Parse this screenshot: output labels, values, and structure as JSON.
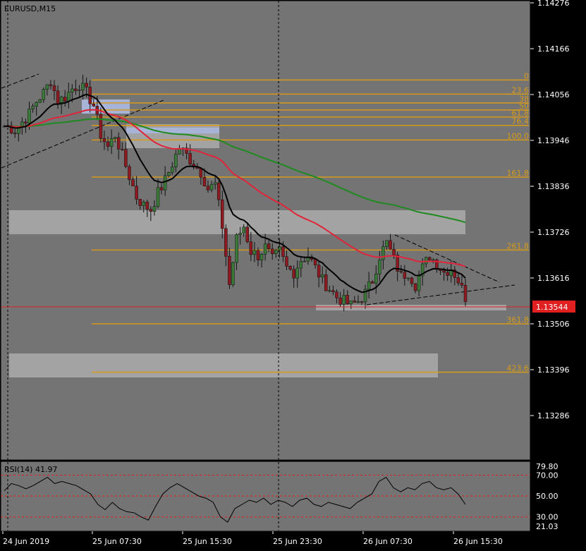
{
  "window": {
    "title": "EURUSD,M15",
    "rsi_title": "RSI(14) 41.97"
  },
  "colors": {
    "background": "#747474",
    "frame": "#000000",
    "candle_up": "#3a7a38",
    "candle_down": "#8c1a20",
    "ema_fast": "#000000",
    "ema_mid": "#e0253a",
    "ema_slow": "#1f8a1f",
    "fib": "#d79a1a",
    "zone": "#a3a3a3",
    "zone_blue": "#a7b4d8",
    "price_line": "#e02020",
    "price_tag_bg": "#e02020",
    "rsi_line": "#000000",
    "rsi_level": "#e02020"
  },
  "price_axis": {
    "ticks": [
      "1.14276",
      "1.14166",
      "1.14056",
      "1.13946",
      "1.13836",
      "1.13726",
      "1.13616",
      "1.13506",
      "1.13396",
      "1.13286"
    ],
    "current_price": "1.13544",
    "range": [
      1.132,
      1.14286
    ]
  },
  "time_axis": {
    "labels": [
      "24 Jun 2019",
      "25 Jun 07:30",
      "25 Jun 15:30",
      "25 Jun 23:30",
      "26 Jun 07:30",
      "26 Jun 15:30"
    ]
  },
  "fibonacci": {
    "levels": [
      {
        "label": "0",
        "price": 1.14091
      },
      {
        "label": "23.6",
        "price": 1.14057
      },
      {
        "label": "38",
        "price": 1.14036
      },
      {
        "label": "50",
        "price": 1.14019
      },
      {
        "label": "61.8",
        "price": 1.14002
      },
      {
        "label": "76.4",
        "price": 1.13982
      },
      {
        "label": "100.0",
        "price": 1.13947
      },
      {
        "label": "161.8",
        "price": 1.13858
      },
      {
        "label": "261.8",
        "price": 1.13683
      },
      {
        "label": "361.8",
        "price": 1.13506
      },
      {
        "label": "423.6",
        "price": 1.1339
      }
    ]
  },
  "rsi_axis": {
    "ticks": [
      "70.00",
      "50.00",
      "30.00",
      "21.03"
    ],
    "top_value": "79.80",
    "levels": [
      70,
      50,
      30
    ],
    "range": [
      21.03,
      79.8
    ]
  },
  "chart_data": {
    "type": "candlestick",
    "title": "EURUSD,M15",
    "series": [
      {
        "name": "price",
        "values": [
          1.1398,
          1.1397,
          1.1399,
          1.1401,
          1.1404,
          1.1406,
          1.1409,
          1.1404,
          1.1405,
          1.1407,
          1.1408,
          1.1406,
          1.1403,
          1.1396,
          1.1393,
          1.1396,
          1.1391,
          1.1386,
          1.1381,
          1.1379,
          1.1378,
          1.1382,
          1.1385,
          1.1389,
          1.1393,
          1.1391,
          1.1389,
          1.1387,
          1.1383,
          1.1384,
          1.1374,
          1.136,
          1.1371,
          1.1374,
          1.1368,
          1.1367,
          1.1369,
          1.1366,
          1.1368,
          1.1364,
          1.1363,
          1.1366,
          1.1367,
          1.1364,
          1.1361,
          1.1359,
          1.1357,
          1.1356,
          1.1355,
          1.1356,
          1.1358,
          1.1361,
          1.1367,
          1.137,
          1.1366,
          1.1362,
          1.1363,
          1.136,
          1.1364,
          1.1367,
          1.1365,
          1.1363,
          1.1364,
          1.1361,
          1.1357
        ]
      },
      {
        "name": "rsi",
        "values": [
          55,
          62,
          60,
          57,
          60,
          64,
          68,
          62,
          64,
          62,
          60,
          56,
          52,
          42,
          37,
          44,
          38,
          35,
          34,
          30,
          27,
          40,
          52,
          58,
          62,
          58,
          54,
          50,
          48,
          44,
          30,
          25,
          38,
          42,
          46,
          44,
          48,
          42,
          46,
          44,
          40,
          46,
          48,
          42,
          40,
          44,
          42,
          40,
          38,
          44,
          48,
          52,
          64,
          68,
          58,
          54,
          58,
          56,
          62,
          64,
          58,
          56,
          58,
          52,
          42
        ]
      }
    ],
    "ylim": [
      1.132,
      1.14286
    ]
  }
}
